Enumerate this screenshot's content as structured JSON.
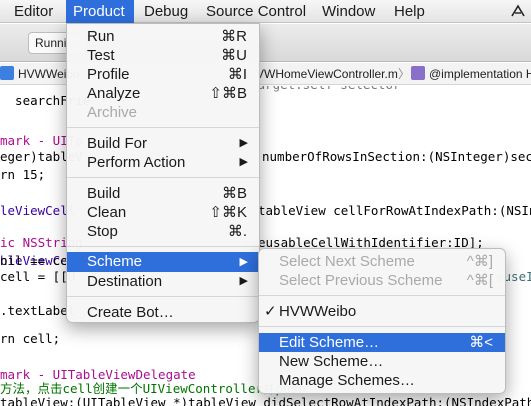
{
  "menubar": {
    "items": [
      "Editor",
      "Product",
      "Debug",
      "Source Control",
      "Window",
      "Help"
    ],
    "active": "Product"
  },
  "toolbar": {
    "run_status": "Runni"
  },
  "jumpbar": {
    "project": "HVWWeibo",
    "file": "VWHomeViewController.m",
    "symbol": "@implementation H"
  },
  "code": {
    "lines": [
      "  searchFrie",
      "",
      "mark - UITa",
      "eger)tableV",
      "rn 15;",
      "",
      "leViewCell",
      "",
      "ic NSString",
      "bleViewCell",
      "nil == cel",
      "cell = [[U",
      "",
      ".textLabel",
      "",
      "rn cell;",
      "",
      "mark - UITableViewDelegate",
      "方法，点击cell创建一个UIViewController并push",
      "tableView:(UITableView *)tableView didSelectRowAtIndexPath:(NSIndexPath *)indexP"
    ],
    "right_fragments": {
      "number_of_rows": "numberOfRowsInSection:(NSInteger)section",
      "cell_for_row": "tableView cellForRowAtIndexPath:(NSIndexPat",
      "dequeue": "eusableCellWithIdentifier:ID];",
      "reuse": "euseI",
      "top_right": "target:self selector"
    }
  },
  "product_menu": {
    "items": [
      {
        "label": "Run",
        "shortcut": "⌘R",
        "enabled": true
      },
      {
        "label": "Test",
        "shortcut": "⌘U",
        "enabled": true
      },
      {
        "label": "Profile",
        "shortcut": "⌘I",
        "enabled": true
      },
      {
        "label": "Analyze",
        "shortcut": "⇧⌘B",
        "enabled": true
      },
      {
        "label": "Archive",
        "shortcut": "",
        "enabled": false
      },
      {
        "label": "Build For",
        "submenu": true
      },
      {
        "label": "Perform Action",
        "submenu": true
      },
      {
        "label": "Build",
        "shortcut": "⌘B",
        "enabled": true
      },
      {
        "label": "Clean",
        "shortcut": "⇧⌘K",
        "enabled": true
      },
      {
        "label": "Stop",
        "shortcut": "⌘.",
        "enabled": true
      },
      {
        "label": "Scheme",
        "submenu": true,
        "highlighted": true
      },
      {
        "label": "Destination",
        "submenu": true
      },
      {
        "label": "Create Bot…",
        "shortcut": ""
      }
    ]
  },
  "scheme_submenu": {
    "items": [
      {
        "label": "Select Next Scheme",
        "shortcut": "^⌘]",
        "enabled": false
      },
      {
        "label": "Select Previous Scheme",
        "shortcut": "^⌘[",
        "enabled": false
      },
      {
        "label": "HVWWeibo",
        "checked": true
      },
      {
        "label": "Edit Scheme…",
        "shortcut": "⌘<",
        "highlighted": true
      },
      {
        "label": "New Scheme…"
      },
      {
        "label": "Manage Schemes…"
      }
    ]
  },
  "colors": {
    "menu_highlight": "#2e6fdc",
    "comment_green": "#007400",
    "type_blue": "#3900a0",
    "keyword_purple": "#aa0d91"
  }
}
